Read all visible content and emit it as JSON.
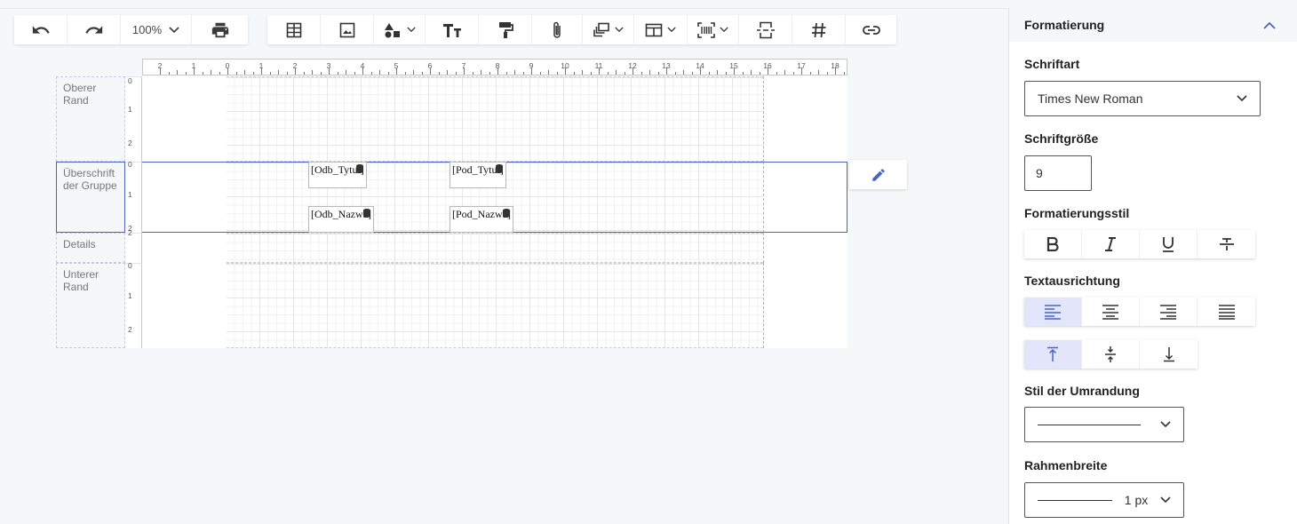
{
  "toolbar": {
    "zoom": "100%"
  },
  "designer": {
    "ruler_numbers": [
      "2",
      "1",
      "0",
      "1",
      "2",
      "3",
      "4",
      "5",
      "6",
      "7",
      "8",
      "9",
      "10",
      "11",
      "12",
      "13",
      "14",
      "15",
      "16",
      "17",
      "18"
    ],
    "bands": [
      {
        "label": "Oberer Rand"
      },
      {
        "label": "Überschrift der Gruppe"
      },
      {
        "label": "Details"
      },
      {
        "label": "Unterer Rand"
      }
    ],
    "fields": {
      "odb_tytul": "[Odb_Tytul]",
      "pod_tytul": "[Pod_Tytul]",
      "odb_nazwa": "[Odb_Nazwa]",
      "pod_nazwa": "[Pod_Nazwa]"
    }
  },
  "panel": {
    "title": "Formatierung",
    "font_label": "Schriftart",
    "font_value": "Times New Roman",
    "size_label": "Schriftgröße",
    "size_value": "9",
    "style_label": "Formatierungsstil",
    "align_label": "Textausrichtung",
    "border_style_label": "Stil der Umrandung",
    "border_width_label": "Rahmenbreite",
    "border_width_value": "1 px"
  },
  "colors": {
    "accent": "#4a63c7",
    "active_bg": "#e3e6fb"
  }
}
